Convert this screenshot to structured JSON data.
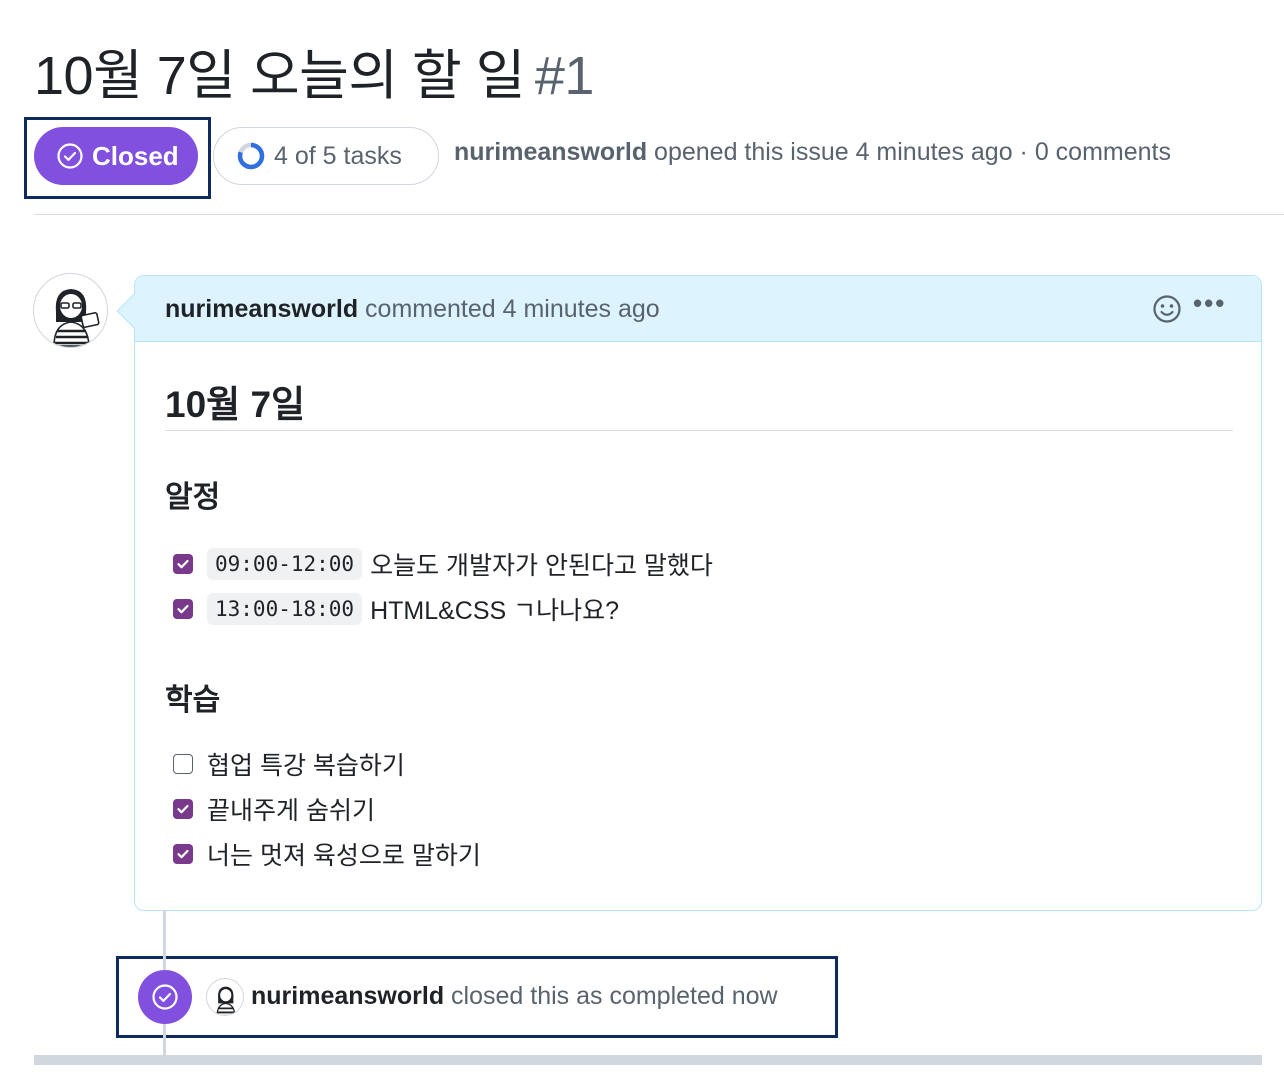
{
  "issue": {
    "title": "10월 7일 오늘의 할 일",
    "number": "#1",
    "state_label": "Closed",
    "tasks_label": "4 of 5 tasks",
    "tasks_done": 4,
    "tasks_total": 5,
    "author": "nurimeansworld",
    "meta_text": "opened this issue 4 minutes ago · 0 comments"
  },
  "comment": {
    "author": "nurimeansworld",
    "action_text": "commented 4 minutes ago",
    "heading": "10월 7일",
    "sections": [
      {
        "title": "알정",
        "tasks": [
          {
            "checked": true,
            "code": "09:00-12:00",
            "text": "오늘도 개발자가 안된다고 말했다"
          },
          {
            "checked": true,
            "code": "13:00-18:00",
            "text": "HTML&CSS ㄱ나나요?"
          }
        ]
      },
      {
        "title": "학습",
        "tasks": [
          {
            "checked": false,
            "code": "",
            "text": "협업 특강 복습하기"
          },
          {
            "checked": true,
            "code": "",
            "text": "끝내주게 숨쉬기"
          },
          {
            "checked": true,
            "code": "",
            "text": "너는 멋져 육성으로 말하기"
          }
        ]
      }
    ]
  },
  "event": {
    "author": "nurimeansworld",
    "text": "closed this as completed now"
  },
  "colors": {
    "closed_purple": "#8250df",
    "checkbox_purple": "#7a3a8c",
    "header_blue": "#ddf4ff",
    "highlight_navy": "#0d2b5e"
  },
  "icons": {
    "state": "check-circle-icon",
    "tasks": "progress-ring-icon",
    "emoji": "smiley-icon",
    "more": "kebab-horizontal-icon"
  }
}
